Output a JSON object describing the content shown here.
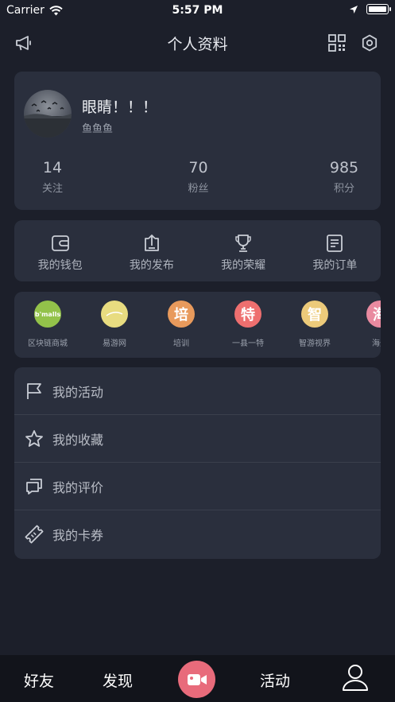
{
  "status": {
    "carrier": "Carrier",
    "time": "5:57 PM"
  },
  "nav": {
    "title": "个人资料",
    "left_icon": "megaphone-icon",
    "right_icons": [
      "qr-code-icon",
      "settings-icon"
    ]
  },
  "profile": {
    "name": "眼睛！！！",
    "subtitle": "鱼鱼鱼",
    "stats": [
      {
        "value": "14",
        "label": "关注"
      },
      {
        "value": "70",
        "label": "粉丝"
      },
      {
        "value": "985",
        "label": "积分"
      }
    ]
  },
  "shortcuts": [
    {
      "label": "我的钱包",
      "icon": "wallet-icon"
    },
    {
      "label": "我的发布",
      "icon": "upload-icon"
    },
    {
      "label": "我的荣耀",
      "icon": "trophy-icon"
    },
    {
      "label": "我的订单",
      "icon": "order-icon"
    }
  ],
  "partners": [
    {
      "label": "区块链商城",
      "logo_text": "b'malls",
      "color": "#93c24a"
    },
    {
      "label": "易游网",
      "logo_text": "",
      "color": "#e8dc80"
    },
    {
      "label": "培训",
      "logo_text": "培",
      "color": "#e89a5c"
    },
    {
      "label": "一县一特",
      "logo_text": "特",
      "color": "#ee6f6f"
    },
    {
      "label": "智游视界",
      "logo_text": "智",
      "color": "#ecca7a"
    },
    {
      "label": "海外",
      "logo_text": "海",
      "color": "#e98aa0"
    }
  ],
  "menu": [
    {
      "label": "我的活动",
      "icon": "flag-icon"
    },
    {
      "label": "我的收藏",
      "icon": "star-icon"
    },
    {
      "label": "我的评价",
      "icon": "comment-icon"
    },
    {
      "label": "我的卡券",
      "icon": "ticket-icon"
    }
  ],
  "tabbar": {
    "friends": "好友",
    "discover": "发现",
    "activity": "活动",
    "camera_icon": "video-camera-icon",
    "profile_icon": "user-icon"
  }
}
